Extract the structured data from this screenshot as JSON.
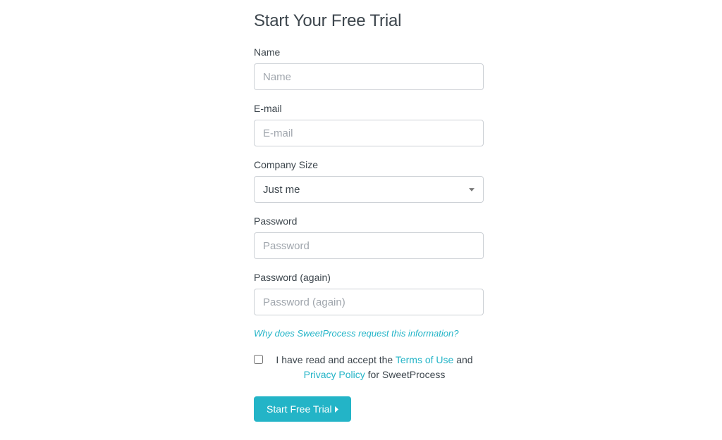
{
  "form": {
    "title": "Start Your Free Trial",
    "name": {
      "label": "Name",
      "placeholder": "Name"
    },
    "email": {
      "label": "E-mail",
      "placeholder": "E-mail"
    },
    "company_size": {
      "label": "Company Size",
      "selected": "Just me"
    },
    "password": {
      "label": "Password",
      "placeholder": "Password"
    },
    "password_again": {
      "label": "Password (again)",
      "placeholder": "Password (again)"
    },
    "info_link": "Why does SweetProcess request this information?",
    "consent": {
      "prefix": "I have read and accept the ",
      "terms_link": "Terms of Use",
      "mid": " and ",
      "privacy_link": "Privacy Policy",
      "suffix": " for SweetProcess"
    },
    "submit_label": "Start Free Trial"
  }
}
